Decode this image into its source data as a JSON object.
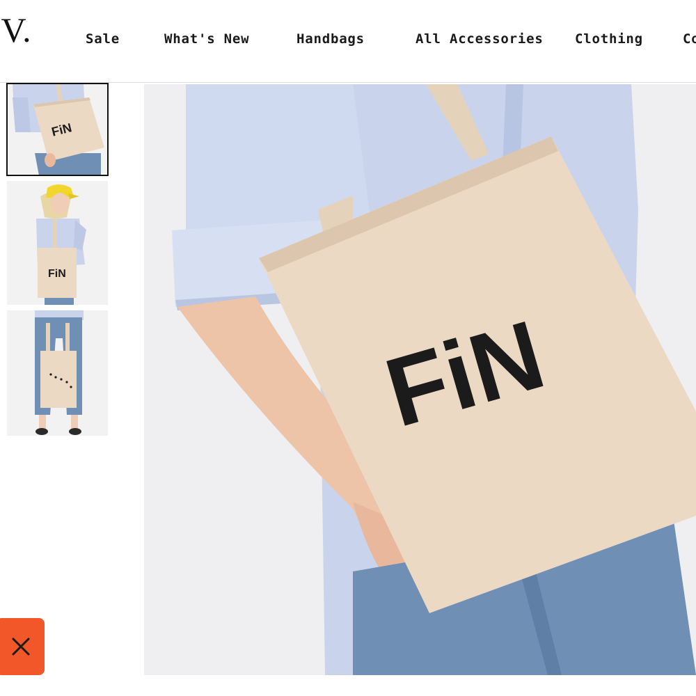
{
  "header": {
    "logo_text": ".V.",
    "nav": [
      {
        "label": "Sale"
      },
      {
        "label": "What's New"
      },
      {
        "label": "Handbags"
      },
      {
        "label": "All Accessories"
      },
      {
        "label": "Clothing"
      },
      {
        "label": "Co"
      }
    ]
  },
  "product": {
    "bag_print": "FiN",
    "thumbnails": [
      {
        "name": "thumbnail-1",
        "print": "FiN",
        "active": true
      },
      {
        "name": "thumbnail-2",
        "print": "FiN",
        "active": false
      },
      {
        "name": "thumbnail-3",
        "print": "",
        "active": false
      }
    ]
  },
  "colors": {
    "close_button": "#f2572a",
    "canvas": "#ecd9c3",
    "shirt": "#c9d4ec",
    "denim": "#6f8fb5"
  },
  "icons": {
    "close": "close-icon"
  }
}
